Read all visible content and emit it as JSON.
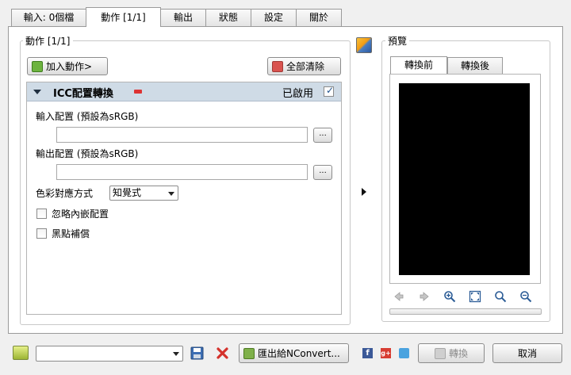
{
  "tabs": [
    {
      "label": "輸入: 0個檔"
    },
    {
      "label": "動作 [1/1]"
    },
    {
      "label": "輸出"
    },
    {
      "label": "狀態"
    },
    {
      "label": "設定"
    },
    {
      "label": "關於"
    }
  ],
  "actions_panel": {
    "legend": "動作 [1/1]",
    "add_button": "加入動作>",
    "clear_button": "全部清除"
  },
  "action": {
    "title": "ICC配置轉換",
    "enabled_label": "已啟用",
    "enabled": true,
    "input_profile_label": "輸入配置 (預設為sRGB)",
    "input_profile_value": "",
    "output_profile_label": "輸出配置 (預設為sRGB)",
    "output_profile_value": "",
    "browse_label": "...",
    "rendering_intent_label": "色彩對應方式",
    "rendering_intent_value": "知覺式",
    "ignore_embedded_label": "忽略內嵌配置",
    "ignore_embedded_checked": false,
    "black_point_label": "黑點補償",
    "black_point_checked": false
  },
  "preview": {
    "legend": "預覽",
    "tab_before": "轉換前",
    "tab_after": "轉換後",
    "nav_icons": [
      "arrow-left-icon",
      "arrow-right-icon",
      "zoom-in-icon",
      "fit-icon",
      "zoom-icon",
      "zoom-out-icon"
    ]
  },
  "bottom": {
    "script_select_value": "",
    "export_button": "匯出給NConvert...",
    "convert_button": "轉換",
    "cancel_button": "取消"
  }
}
